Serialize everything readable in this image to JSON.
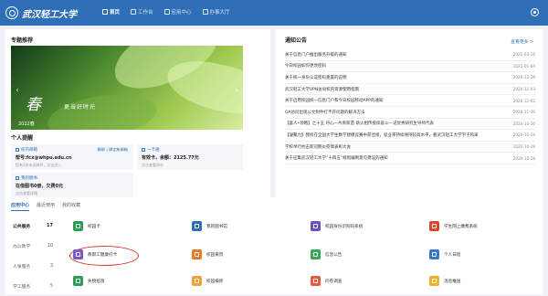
{
  "header": {
    "logo_text": "武汉轻工大学",
    "nav": [
      {
        "label": "首页",
        "icon": "home-icon",
        "active": true
      },
      {
        "label": "工作台",
        "icon": "desk-icon",
        "active": false
      },
      {
        "label": "应用中心",
        "icon": "grid-icon",
        "active": false
      },
      {
        "label": "办事大厅",
        "icon": "hall-icon",
        "active": false
      }
    ],
    "user_icon": "user-icon"
  },
  "featured": {
    "title": "专题推荐",
    "banner_big": "春",
    "banner_sub": "更当好时光",
    "banner_year": "2022春"
  },
  "reminder": {
    "title": "个人提醒",
    "mail": {
      "label": "校内邮箱",
      "links": "解绑 | 绑定新邮箱",
      "address": "帮号:fcx@whpu.edu.cn",
      "hint": "您有1封未读邮件，点击进入"
    },
    "card": {
      "label": "一卡通",
      "value": "有效卡，余额：2125.77元",
      "hint": "点击查看流水"
    },
    "borrow": {
      "label": "我的图书",
      "value": "在借图书0册，欠费0元",
      "hint": "点击查看详情"
    }
  },
  "notices": {
    "title": "通知公告",
    "more": "查看更多 >",
    "items": [
      {
        "title": "关于信息门户推出服务升级的通知",
        "date": "2021-03-16"
      },
      {
        "title": "今日校园如何更改密码",
        "date": "2021-01-04"
      },
      {
        "title": "关于统一身份认证密码重置的说明",
        "date": "2020-12-29"
      },
      {
        "title": "武汉轻工大学VPN访问校内资源使用指南",
        "date": "2020-12-03"
      },
      {
        "title": "关于启用校园统一信息门户和今日校园移动APP的通知",
        "date": "2020-12-02"
      },
      {
        "title": "OA访问出现公文附件打不开问题的解决方法",
        "date": "2020-11-30"
      },
      {
        "title": "【喜人•领略】之十五 丹心一片育新苗 薪火相传接续奋斗—记优秀研究生导师代表",
        "date": "2020-10-30"
      },
      {
        "title": "【凝聚力】我校在全国大学生数学建模竞赛中获佳绩，就业率持续保持较高水平，看武汉轻工大学学子风采",
        "date": "2020-10-29"
      },
      {
        "title": "学校举行抗击新冠肺炎疫情表彰大会",
        "date": "2020-10-29"
      },
      {
        "title": "关于征集武汉轻工大学“十四五”规划编制意见建议的通知",
        "date": "2020-10-28"
      }
    ]
  },
  "apps": {
    "tabs": [
      {
        "label": "应用中心",
        "active": true
      },
      {
        "label": "最近使用",
        "active": false
      },
      {
        "label": "我的收藏",
        "active": false
      }
    ],
    "categories": [
      {
        "label": "公共服务",
        "count": "17",
        "active": true
      },
      {
        "label": "办公教学",
        "count": "10",
        "active": false
      },
      {
        "label": "人事服务",
        "count": "3",
        "active": false
      },
      {
        "label": "学工服务",
        "count": "5",
        "active": false
      }
    ],
    "items": [
      {
        "label": "校园卡",
        "icon": "card-icon",
        "color": "#2e9c55"
      },
      {
        "label": "我的图书馆",
        "icon": "library-icon",
        "color": "#2f6fb8"
      },
      {
        "label": "校园身份识别码系统",
        "icon": "qrcode-icon",
        "color": "#6b4fbf"
      },
      {
        "label": "学生网上缴费系统",
        "icon": "payment-icon",
        "color": "#d9452f"
      },
      {
        "label": "教职工健康打卡",
        "icon": "health-icon",
        "color": "#7b59c4"
      },
      {
        "label": "校园黄页",
        "icon": "yellowpages-icon",
        "color": "#e67b2a"
      },
      {
        "label": "信息公告",
        "icon": "announce-icon",
        "color": "#3aa856"
      },
      {
        "label": "个人日程",
        "icon": "calendar-icon",
        "color": "#3778c4"
      },
      {
        "label": "失物招领",
        "icon": "lostfound-icon",
        "color": "#2e9c55"
      },
      {
        "label": "校园报修",
        "icon": "repair-icon",
        "color": "#f1a33a"
      },
      {
        "label": "问卷调查",
        "icon": "survey-icon",
        "color": "#e85a3b"
      },
      {
        "label": "消息推送",
        "icon": "message-icon",
        "color": "#f0b132"
      }
    ]
  }
}
